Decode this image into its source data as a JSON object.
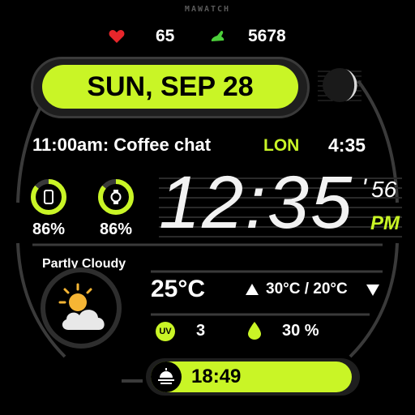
{
  "brand": "MAWATCH",
  "stats": {
    "heart_rate": "65",
    "steps": "5678"
  },
  "date": {
    "label": "SUN, SEP 28"
  },
  "event": {
    "text": "11:00am: Coffee chat"
  },
  "world_clock": {
    "city": "LON",
    "time": "4:35"
  },
  "batteries": [
    {
      "icon": "phone-icon",
      "percent": "86%",
      "level": 0.86
    },
    {
      "icon": "watch-icon",
      "percent": "86%",
      "level": 0.86
    }
  ],
  "clock": {
    "time": "12:35",
    "seconds": "56",
    "ampm": "PM",
    "apostrophe": "'"
  },
  "weather": {
    "condition": "Partly Cloudy",
    "icon": "partly-cloudy-icon",
    "temperature": "25°C",
    "high_low": "30°C / 20°C",
    "uv_label": "UV",
    "uv_index": "3",
    "humidity": "30 %"
  },
  "sunset": {
    "icon": "sunset-icon",
    "time": "18:49"
  },
  "colors": {
    "accent": "#c9f526",
    "background": "#000000",
    "bezel": "#2e2e2e",
    "heart": "#e8262b"
  }
}
